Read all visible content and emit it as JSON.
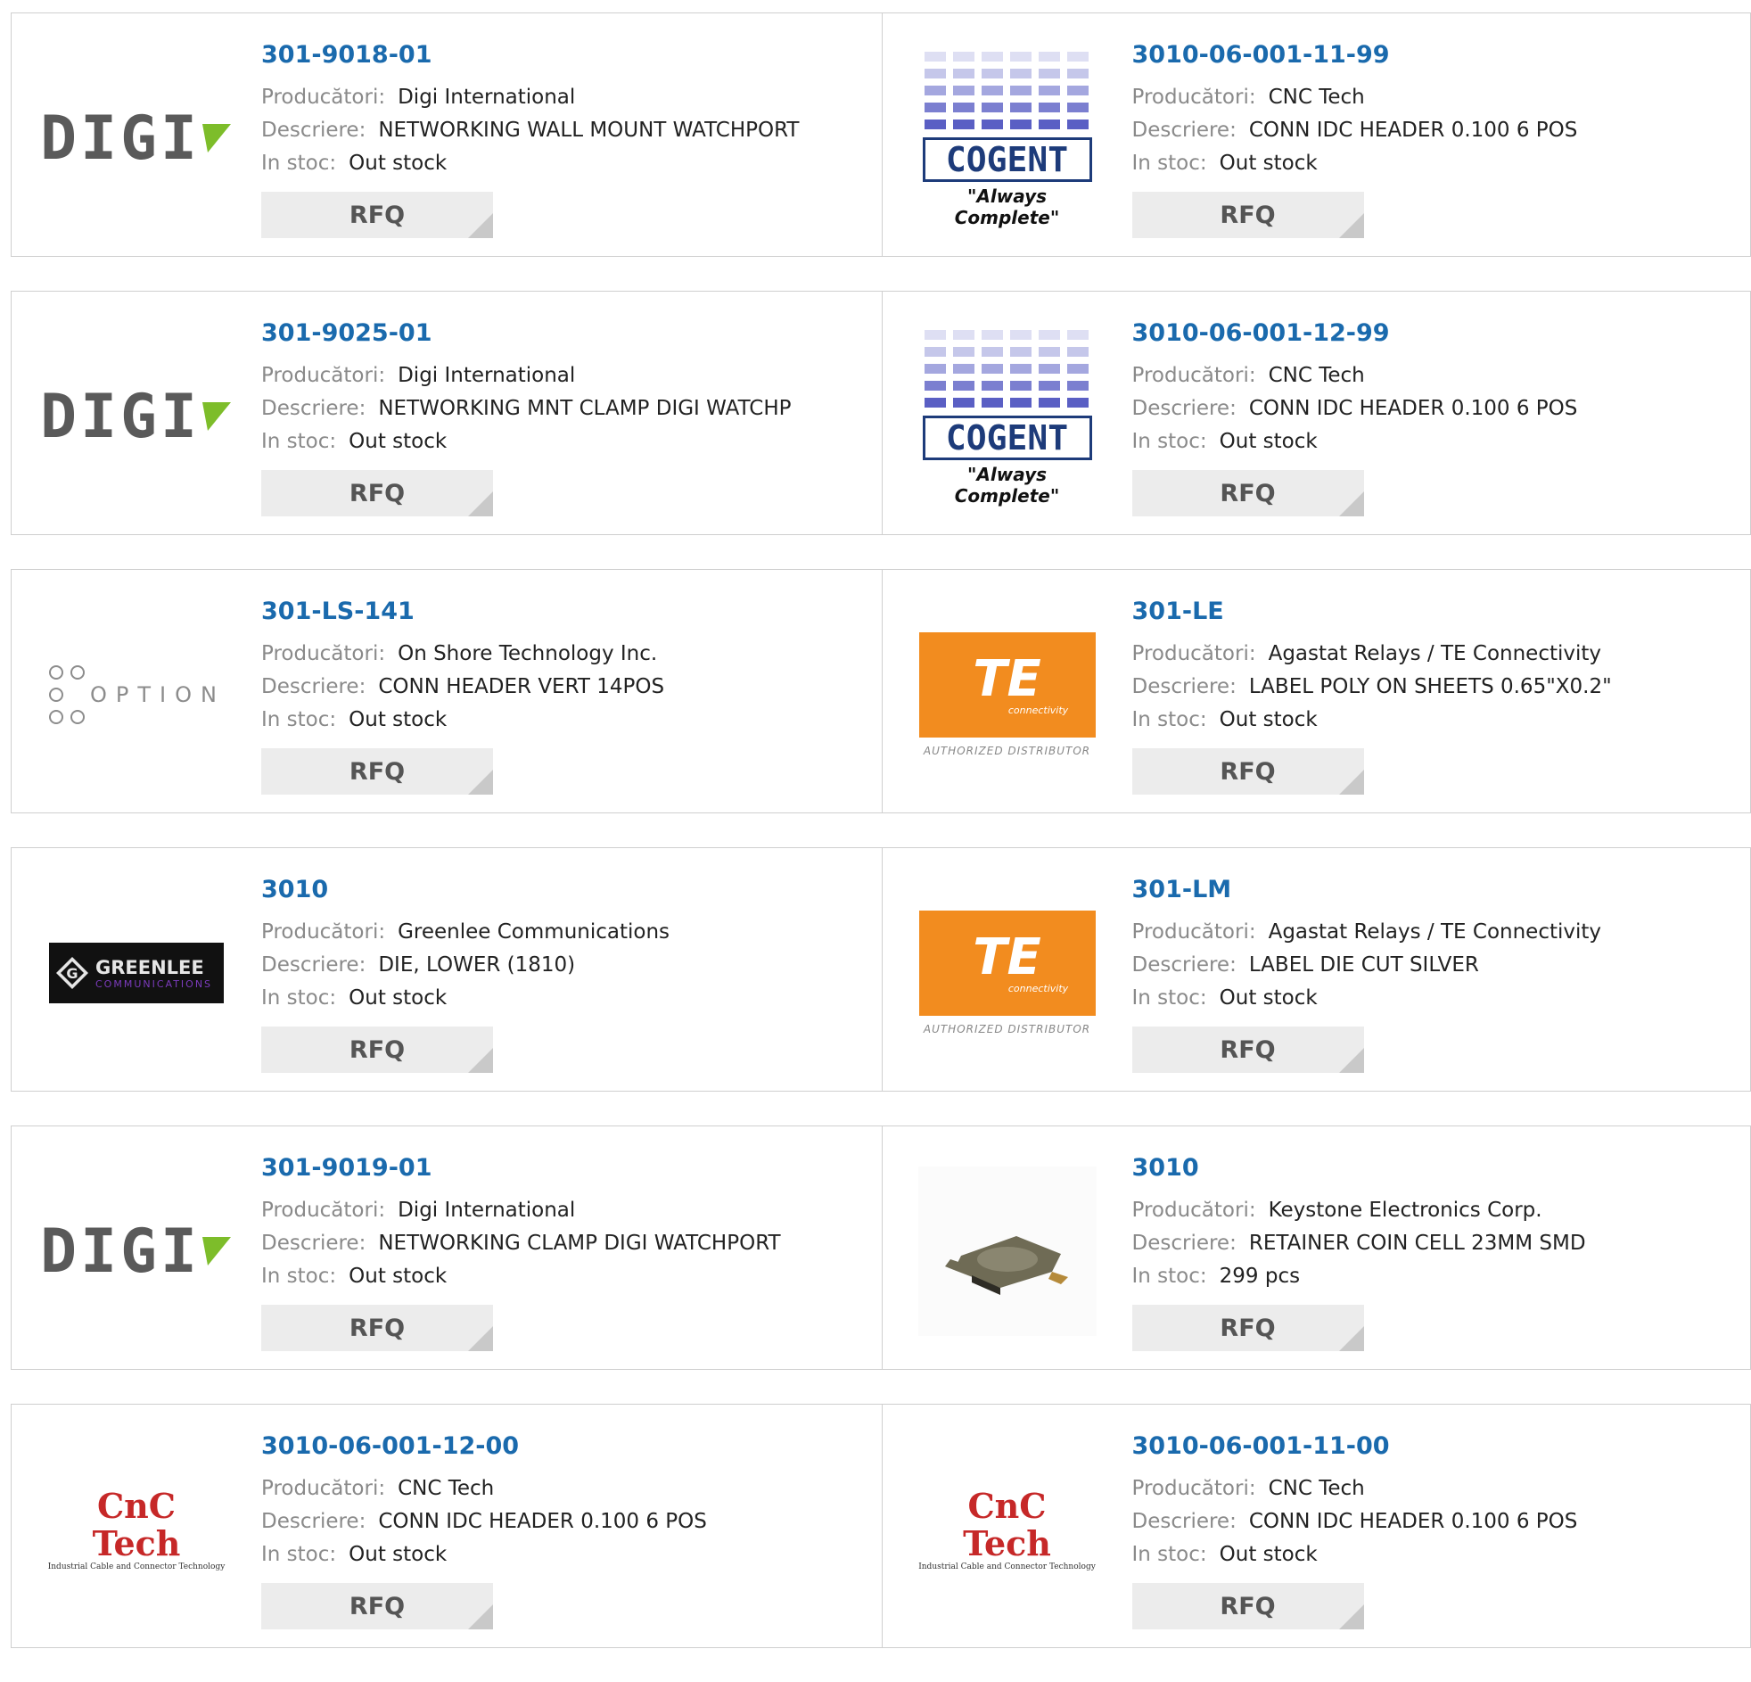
{
  "labels": {
    "manufacturer": "Producători:",
    "description": "Descriere:",
    "stock": "In stoc:",
    "rfq": "RFQ"
  },
  "logos": {
    "digi": {
      "text": "DIGI",
      "accent": "#7dbd2a",
      "text_color": "#5a5a5a"
    },
    "cogent": {
      "word": "COGENT",
      "tagline": "\"Always Complete\"",
      "color": "#1d3b7a",
      "bars": "#5a5fc4"
    },
    "option": {
      "text": "OPTION",
      "color": "#8c8c8c"
    },
    "te": {
      "mark": "TE",
      "sub": "connectivity",
      "footer": "AUTHORIZED DISTRIBUTOR",
      "color": "#f28c1f"
    },
    "greenlee": {
      "mark": "G",
      "title": "GREENLEE",
      "sub": "COMMUNICATIONS",
      "color": "#111111"
    },
    "cnc": {
      "title": "CnC Tech",
      "sub": "Industrial Cable and Connector Technology",
      "color": "#c62828"
    },
    "keystone": {
      "icon": "coin-cell-retainer"
    }
  },
  "colors": {
    "part_number": "#1a6aad",
    "label": "#8a8a8a",
    "value": "#222222",
    "border": "#cfcfcf",
    "rfq_bg": "#ececec"
  },
  "products": [
    {
      "part": "301-9018-01",
      "manufacturer": "Digi International",
      "description": "NETWORKING WALL MOUNT WATCHPORT",
      "stock": "Out stock",
      "logo": "digi"
    },
    {
      "part": "3010-06-001-11-99",
      "manufacturer": "CNC Tech",
      "description": "CONN IDC HEADER 0.100 6 POS",
      "stock": "Out stock",
      "logo": "cogent"
    },
    {
      "part": "301-9025-01",
      "manufacturer": "Digi International",
      "description": "NETWORKING MNT CLAMP DIGI WATCHP",
      "stock": "Out stock",
      "logo": "digi"
    },
    {
      "part": "3010-06-001-12-99",
      "manufacturer": "CNC Tech",
      "description": "CONN IDC HEADER 0.100 6 POS",
      "stock": "Out stock",
      "logo": "cogent"
    },
    {
      "part": "301-LS-141",
      "manufacturer": "On Shore Technology Inc.",
      "description": "CONN HEADER VERT 14POS",
      "stock": "Out stock",
      "logo": "option"
    },
    {
      "part": "301-LE",
      "manufacturer": "Agastat Relays / TE Connectivity",
      "description": "LABEL POLY ON SHEETS 0.65\"X0.2\"",
      "stock": "Out stock",
      "logo": "te"
    },
    {
      "part": "3010",
      "manufacturer": "Greenlee Communications",
      "description": "DIE, LOWER (1810)",
      "stock": "Out stock",
      "logo": "greenlee"
    },
    {
      "part": "301-LM",
      "manufacturer": "Agastat Relays / TE Connectivity",
      "description": "LABEL DIE CUT SILVER",
      "stock": "Out stock",
      "logo": "te"
    },
    {
      "part": "301-9019-01",
      "manufacturer": "Digi International",
      "description": "NETWORKING CLAMP DIGI WATCHPORT",
      "stock": "Out stock",
      "logo": "digi"
    },
    {
      "part": "3010",
      "manufacturer": "Keystone Electronics Corp.",
      "description": "RETAINER COIN CELL 23MM SMD",
      "stock": "299 pcs",
      "logo": "keystone"
    },
    {
      "part": "3010-06-001-12-00",
      "manufacturer": "CNC Tech",
      "description": "CONN IDC HEADER 0.100 6 POS",
      "stock": "Out stock",
      "logo": "cnc"
    },
    {
      "part": "3010-06-001-11-00",
      "manufacturer": "CNC Tech",
      "description": "CONN IDC HEADER 0.100 6 POS",
      "stock": "Out stock",
      "logo": "cnc"
    }
  ]
}
